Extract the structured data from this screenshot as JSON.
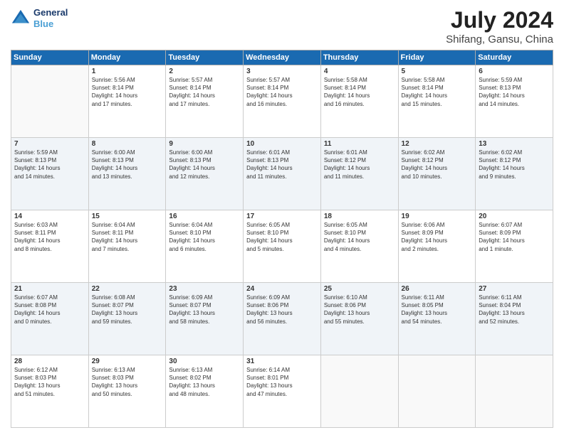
{
  "header": {
    "logo_line1": "General",
    "logo_line2": "Blue",
    "main_title": "July 2024",
    "sub_title": "Shifang, Gansu, China"
  },
  "days_of_week": [
    "Sunday",
    "Monday",
    "Tuesday",
    "Wednesday",
    "Thursday",
    "Friday",
    "Saturday"
  ],
  "weeks": [
    [
      {
        "num": "",
        "info": ""
      },
      {
        "num": "1",
        "info": "Sunrise: 5:56 AM\nSunset: 8:14 PM\nDaylight: 14 hours\nand 17 minutes."
      },
      {
        "num": "2",
        "info": "Sunrise: 5:57 AM\nSunset: 8:14 PM\nDaylight: 14 hours\nand 17 minutes."
      },
      {
        "num": "3",
        "info": "Sunrise: 5:57 AM\nSunset: 8:14 PM\nDaylight: 14 hours\nand 16 minutes."
      },
      {
        "num": "4",
        "info": "Sunrise: 5:58 AM\nSunset: 8:14 PM\nDaylight: 14 hours\nand 16 minutes."
      },
      {
        "num": "5",
        "info": "Sunrise: 5:58 AM\nSunset: 8:14 PM\nDaylight: 14 hours\nand 15 minutes."
      },
      {
        "num": "6",
        "info": "Sunrise: 5:59 AM\nSunset: 8:13 PM\nDaylight: 14 hours\nand 14 minutes."
      }
    ],
    [
      {
        "num": "7",
        "info": "Sunrise: 5:59 AM\nSunset: 8:13 PM\nDaylight: 14 hours\nand 14 minutes."
      },
      {
        "num": "8",
        "info": "Sunrise: 6:00 AM\nSunset: 8:13 PM\nDaylight: 14 hours\nand 13 minutes."
      },
      {
        "num": "9",
        "info": "Sunrise: 6:00 AM\nSunset: 8:13 PM\nDaylight: 14 hours\nand 12 minutes."
      },
      {
        "num": "10",
        "info": "Sunrise: 6:01 AM\nSunset: 8:13 PM\nDaylight: 14 hours\nand 11 minutes."
      },
      {
        "num": "11",
        "info": "Sunrise: 6:01 AM\nSunset: 8:12 PM\nDaylight: 14 hours\nand 11 minutes."
      },
      {
        "num": "12",
        "info": "Sunrise: 6:02 AM\nSunset: 8:12 PM\nDaylight: 14 hours\nand 10 minutes."
      },
      {
        "num": "13",
        "info": "Sunrise: 6:02 AM\nSunset: 8:12 PM\nDaylight: 14 hours\nand 9 minutes."
      }
    ],
    [
      {
        "num": "14",
        "info": "Sunrise: 6:03 AM\nSunset: 8:11 PM\nDaylight: 14 hours\nand 8 minutes."
      },
      {
        "num": "15",
        "info": "Sunrise: 6:04 AM\nSunset: 8:11 PM\nDaylight: 14 hours\nand 7 minutes."
      },
      {
        "num": "16",
        "info": "Sunrise: 6:04 AM\nSunset: 8:10 PM\nDaylight: 14 hours\nand 6 minutes."
      },
      {
        "num": "17",
        "info": "Sunrise: 6:05 AM\nSunset: 8:10 PM\nDaylight: 14 hours\nand 5 minutes."
      },
      {
        "num": "18",
        "info": "Sunrise: 6:05 AM\nSunset: 8:10 PM\nDaylight: 14 hours\nand 4 minutes."
      },
      {
        "num": "19",
        "info": "Sunrise: 6:06 AM\nSunset: 8:09 PM\nDaylight: 14 hours\nand 2 minutes."
      },
      {
        "num": "20",
        "info": "Sunrise: 6:07 AM\nSunset: 8:09 PM\nDaylight: 14 hours\nand 1 minute."
      }
    ],
    [
      {
        "num": "21",
        "info": "Sunrise: 6:07 AM\nSunset: 8:08 PM\nDaylight: 14 hours\nand 0 minutes."
      },
      {
        "num": "22",
        "info": "Sunrise: 6:08 AM\nSunset: 8:07 PM\nDaylight: 13 hours\nand 59 minutes."
      },
      {
        "num": "23",
        "info": "Sunrise: 6:09 AM\nSunset: 8:07 PM\nDaylight: 13 hours\nand 58 minutes."
      },
      {
        "num": "24",
        "info": "Sunrise: 6:09 AM\nSunset: 8:06 PM\nDaylight: 13 hours\nand 56 minutes."
      },
      {
        "num": "25",
        "info": "Sunrise: 6:10 AM\nSunset: 8:06 PM\nDaylight: 13 hours\nand 55 minutes."
      },
      {
        "num": "26",
        "info": "Sunrise: 6:11 AM\nSunset: 8:05 PM\nDaylight: 13 hours\nand 54 minutes."
      },
      {
        "num": "27",
        "info": "Sunrise: 6:11 AM\nSunset: 8:04 PM\nDaylight: 13 hours\nand 52 minutes."
      }
    ],
    [
      {
        "num": "28",
        "info": "Sunrise: 6:12 AM\nSunset: 8:03 PM\nDaylight: 13 hours\nand 51 minutes."
      },
      {
        "num": "29",
        "info": "Sunrise: 6:13 AM\nSunset: 8:03 PM\nDaylight: 13 hours\nand 50 minutes."
      },
      {
        "num": "30",
        "info": "Sunrise: 6:13 AM\nSunset: 8:02 PM\nDaylight: 13 hours\nand 48 minutes."
      },
      {
        "num": "31",
        "info": "Sunrise: 6:14 AM\nSunset: 8:01 PM\nDaylight: 13 hours\nand 47 minutes."
      },
      {
        "num": "",
        "info": ""
      },
      {
        "num": "",
        "info": ""
      },
      {
        "num": "",
        "info": ""
      }
    ]
  ]
}
